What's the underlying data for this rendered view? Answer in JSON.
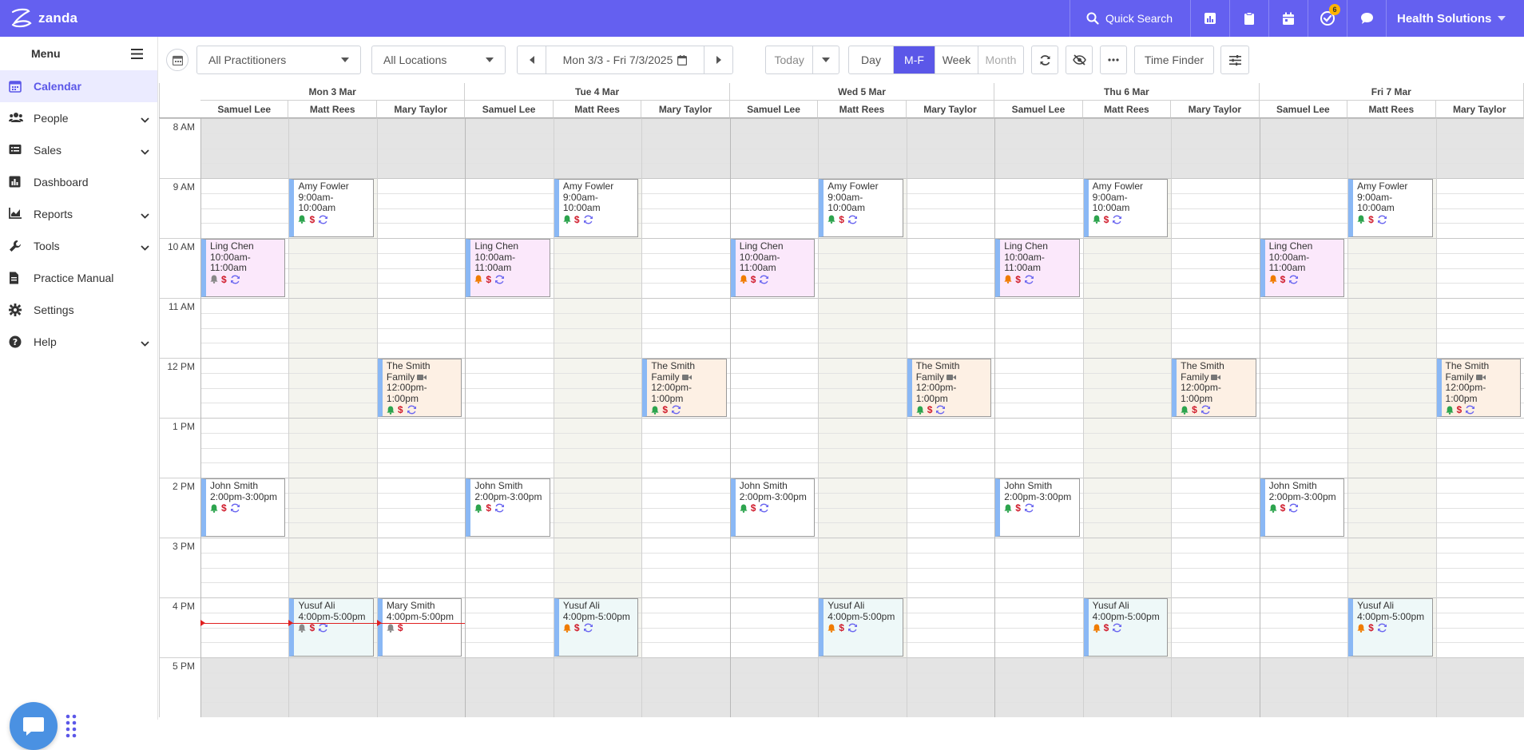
{
  "app": {
    "brand": "zanda",
    "org_name": "Health Solutions",
    "quick_search": "Quick Search",
    "notification_count": "6"
  },
  "sidebar": {
    "title": "Menu",
    "items": [
      {
        "label": "Calendar",
        "icon": "calendar-icon",
        "active": true,
        "expand": false
      },
      {
        "label": "People",
        "icon": "people-icon",
        "active": false,
        "expand": true
      },
      {
        "label": "Sales",
        "icon": "sales-icon",
        "active": false,
        "expand": true
      },
      {
        "label": "Dashboard",
        "icon": "dashboard-icon",
        "active": false,
        "expand": false
      },
      {
        "label": "Reports",
        "icon": "reports-icon",
        "active": false,
        "expand": true
      },
      {
        "label": "Tools",
        "icon": "wrench-icon",
        "active": false,
        "expand": true
      },
      {
        "label": "Practice Manual",
        "icon": "document-icon",
        "active": false,
        "expand": false
      },
      {
        "label": "Settings",
        "icon": "gear-icon",
        "active": false,
        "expand": false
      },
      {
        "label": "Help",
        "icon": "help-icon",
        "active": false,
        "expand": true
      }
    ]
  },
  "toolbar": {
    "practitioners": "All Practitioners",
    "locations": "All Locations",
    "date_range": "Mon 3/3 - Fri 7/3/2025",
    "today": "Today",
    "views": [
      "Day",
      "M-F",
      "Week",
      "Month"
    ],
    "active_view": "M-F",
    "time_finder": "Time Finder"
  },
  "calendar": {
    "days": [
      "Mon 3 Mar",
      "Tue 4 Mar",
      "Wed 5 Mar",
      "Thu 6 Mar",
      "Fri 7 Mar"
    ],
    "practitioners": [
      "Samuel Lee",
      "Matt Rees",
      "Mary Taylor"
    ],
    "hours": [
      "8 AM",
      "9 AM",
      "10 AM",
      "11 AM",
      "12 PM",
      "1 PM",
      "2 PM",
      "3 PM",
      "4 PM",
      "5 PM"
    ],
    "appointments": [
      {
        "day": 0,
        "prac": 1,
        "start": 9,
        "end": 10,
        "name": "Amy Fowler",
        "time": "9:00am-\n10:00am",
        "bell": "#2da44e",
        "video": false,
        "color": "#ffffff"
      },
      {
        "day": 1,
        "prac": 1,
        "start": 9,
        "end": 10,
        "name": "Amy Fowler",
        "time": "9:00am-\n10:00am",
        "bell": "#2da44e",
        "video": false,
        "color": "#ffffff"
      },
      {
        "day": 2,
        "prac": 1,
        "start": 9,
        "end": 10,
        "name": "Amy Fowler",
        "time": "9:00am-\n10:00am",
        "bell": "#2da44e",
        "video": false,
        "color": "#ffffff"
      },
      {
        "day": 3,
        "prac": 1,
        "start": 9,
        "end": 10,
        "name": "Amy Fowler",
        "time": "9:00am-\n10:00am",
        "bell": "#2da44e",
        "video": false,
        "color": "#ffffff"
      },
      {
        "day": 4,
        "prac": 1,
        "start": 9,
        "end": 10,
        "name": "Amy Fowler",
        "time": "9:00am-\n10:00am",
        "bell": "#2da44e",
        "video": false,
        "color": "#ffffff"
      },
      {
        "day": 0,
        "prac": 0,
        "start": 10,
        "end": 11,
        "name": "Ling Chen",
        "time": "10:00am-\n11:00am",
        "bell": "#888888",
        "video": false,
        "color": "#fbe8fb"
      },
      {
        "day": 1,
        "prac": 0,
        "start": 10,
        "end": 11,
        "name": "Ling Chen",
        "time": "10:00am-\n11:00am",
        "bell": "#f07c00",
        "video": false,
        "color": "#fbe8fb"
      },
      {
        "day": 2,
        "prac": 0,
        "start": 10,
        "end": 11,
        "name": "Ling Chen",
        "time": "10:00am-\n11:00am",
        "bell": "#f07c00",
        "video": false,
        "color": "#fbe8fb"
      },
      {
        "day": 3,
        "prac": 0,
        "start": 10,
        "end": 11,
        "name": "Ling Chen",
        "time": "10:00am-\n11:00am",
        "bell": "#f07c00",
        "video": false,
        "color": "#fbe8fb"
      },
      {
        "day": 4,
        "prac": 0,
        "start": 10,
        "end": 11,
        "name": "Ling Chen",
        "time": "10:00am-\n11:00am",
        "bell": "#f07c00",
        "video": false,
        "color": "#fbe8fb"
      },
      {
        "day": 0,
        "prac": 2,
        "start": 12,
        "end": 13,
        "name": "The Smith\nFamily",
        "time": "12:00pm-\n1:00pm",
        "bell": "#2da44e",
        "video": true,
        "color": "#fdf0e4"
      },
      {
        "day": 1,
        "prac": 2,
        "start": 12,
        "end": 13,
        "name": "The Smith\nFamily",
        "time": "12:00pm-\n1:00pm",
        "bell": "#2da44e",
        "video": true,
        "color": "#fdf0e4"
      },
      {
        "day": 2,
        "prac": 2,
        "start": 12,
        "end": 13,
        "name": "The Smith\nFamily",
        "time": "12:00pm-\n1:00pm",
        "bell": "#2da44e",
        "video": true,
        "color": "#fdf0e4"
      },
      {
        "day": 3,
        "prac": 2,
        "start": 12,
        "end": 13,
        "name": "The Smith\nFamily",
        "time": "12:00pm-\n1:00pm",
        "bell": "#2da44e",
        "video": true,
        "color": "#fdf0e4"
      },
      {
        "day": 4,
        "prac": 2,
        "start": 12,
        "end": 13,
        "name": "The Smith\nFamily",
        "time": "12:00pm-\n1:00pm",
        "bell": "#2da44e",
        "video": true,
        "color": "#fdf0e4"
      },
      {
        "day": 0,
        "prac": 0,
        "start": 14,
        "end": 15,
        "name": "John Smith",
        "time": "2:00pm-3:00pm",
        "bell": "#2da44e",
        "video": false,
        "color": "#ffffff"
      },
      {
        "day": 1,
        "prac": 0,
        "start": 14,
        "end": 15,
        "name": "John Smith",
        "time": "2:00pm-3:00pm",
        "bell": "#2da44e",
        "video": false,
        "color": "#ffffff"
      },
      {
        "day": 2,
        "prac": 0,
        "start": 14,
        "end": 15,
        "name": "John Smith",
        "time": "2:00pm-3:00pm",
        "bell": "#2da44e",
        "video": false,
        "color": "#ffffff"
      },
      {
        "day": 3,
        "prac": 0,
        "start": 14,
        "end": 15,
        "name": "John Smith",
        "time": "2:00pm-3:00pm",
        "bell": "#2da44e",
        "video": false,
        "color": "#ffffff"
      },
      {
        "day": 4,
        "prac": 0,
        "start": 14,
        "end": 15,
        "name": "John Smith",
        "time": "2:00pm-3:00pm",
        "bell": "#2da44e",
        "video": false,
        "color": "#ffffff"
      },
      {
        "day": 0,
        "prac": 1,
        "start": 16,
        "end": 17,
        "name": "Yusuf Ali",
        "time": "4:00pm-5:00pm",
        "bell": "#888888",
        "video": false,
        "color": "#eef8f8"
      },
      {
        "day": 0,
        "prac": 2,
        "start": 16,
        "end": 17,
        "name": "Mary Smith",
        "time": "4:00pm-5:00pm",
        "bell": "#888888",
        "video": false,
        "color": "#ffffff",
        "no_repeat": true
      },
      {
        "day": 1,
        "prac": 1,
        "start": 16,
        "end": 17,
        "name": "Yusuf Ali",
        "time": "4:00pm-5:00pm",
        "bell": "#f07c00",
        "video": false,
        "color": "#eef8f8"
      },
      {
        "day": 2,
        "prac": 1,
        "start": 16,
        "end": 17,
        "name": "Yusuf Ali",
        "time": "4:00pm-5:00pm",
        "bell": "#f07c00",
        "video": false,
        "color": "#eef8f8"
      },
      {
        "day": 3,
        "prac": 1,
        "start": 16,
        "end": 17,
        "name": "Yusuf Ali",
        "time": "4:00pm-5:00pm",
        "bell": "#f07c00",
        "video": false,
        "color": "#eef8f8"
      },
      {
        "day": 4,
        "prac": 1,
        "start": 16,
        "end": 17,
        "name": "Yusuf Ali",
        "time": "4:00pm-5:00pm",
        "bell": "#f07c00",
        "video": false,
        "color": "#eef8f8"
      }
    ],
    "now_time": 16.42
  }
}
